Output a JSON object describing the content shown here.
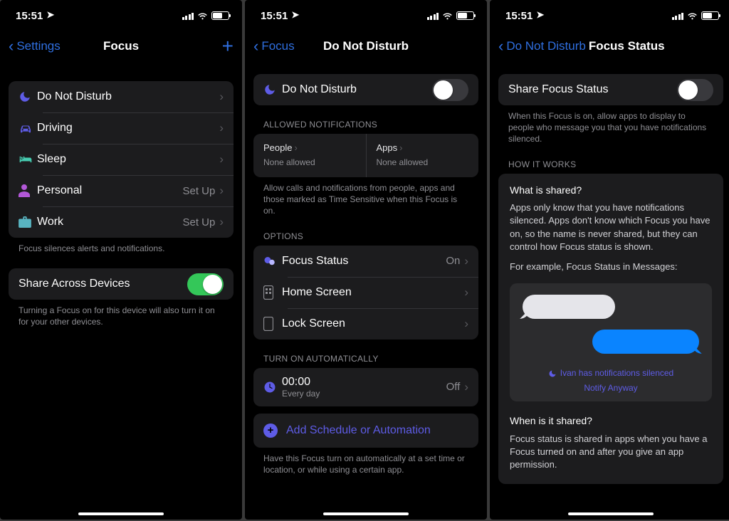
{
  "status": {
    "time": "15:51"
  },
  "phone1": {
    "nav": {
      "back": "Settings",
      "title": "Focus"
    },
    "modes": {
      "dnd": "Do Not Disturb",
      "driving": "Driving",
      "sleep": "Sleep",
      "personal": "Personal",
      "personal_acc": "Set Up",
      "work": "Work",
      "work_acc": "Set Up"
    },
    "foot1": "Focus silences alerts and notifications.",
    "share": {
      "label": "Share Across Devices",
      "on": true
    },
    "foot2": "Turning a Focus on for this device will also turn it on for your other devices."
  },
  "phone2": {
    "nav": {
      "back": "Focus",
      "title": "Do Not Disturb"
    },
    "main_toggle": {
      "label": "Do Not Disturb",
      "on": false
    },
    "allowed": {
      "head": "Allowed Notifications",
      "people_label": "People",
      "people_sub": "None allowed",
      "apps_label": "Apps",
      "apps_sub": "None allowed",
      "foot": "Allow calls and notifications from people, apps and those marked as Time Sensitive when this Focus is on."
    },
    "options": {
      "head": "Options",
      "focus_status": "Focus Status",
      "focus_status_val": "On",
      "home_screen": "Home Screen",
      "lock_screen": "Lock Screen"
    },
    "auto": {
      "head": "Turn On Automatically",
      "time": "00:00",
      "sub": "Every day",
      "val": "Off",
      "add": "Add Schedule or Automation",
      "foot": "Have this Focus turn on automatically at a set time or location, or while using a certain app."
    }
  },
  "phone3": {
    "nav": {
      "back": "Do Not Disturb",
      "title": "Focus Status"
    },
    "share": {
      "label": "Share Focus Status",
      "on": false
    },
    "share_foot": "When this Focus is on, allow apps to display to people who message you that you have notifications silenced.",
    "how_head": "How It Works",
    "what_q": "What is shared?",
    "what_a": "Apps only know that you have notifications silenced. Apps don't know which Focus you have on, so the name is never shared, but they can control how Focus status is shown.",
    "example": "For example, Focus Status in Messages:",
    "silenced_text": "Ivan has notifications silenced",
    "notify_anyway": "Notify Anyway",
    "when_q": "When is it shared?",
    "when_a": "Focus status is shared in apps when you have a Focus turned on and after you give an app permission."
  }
}
